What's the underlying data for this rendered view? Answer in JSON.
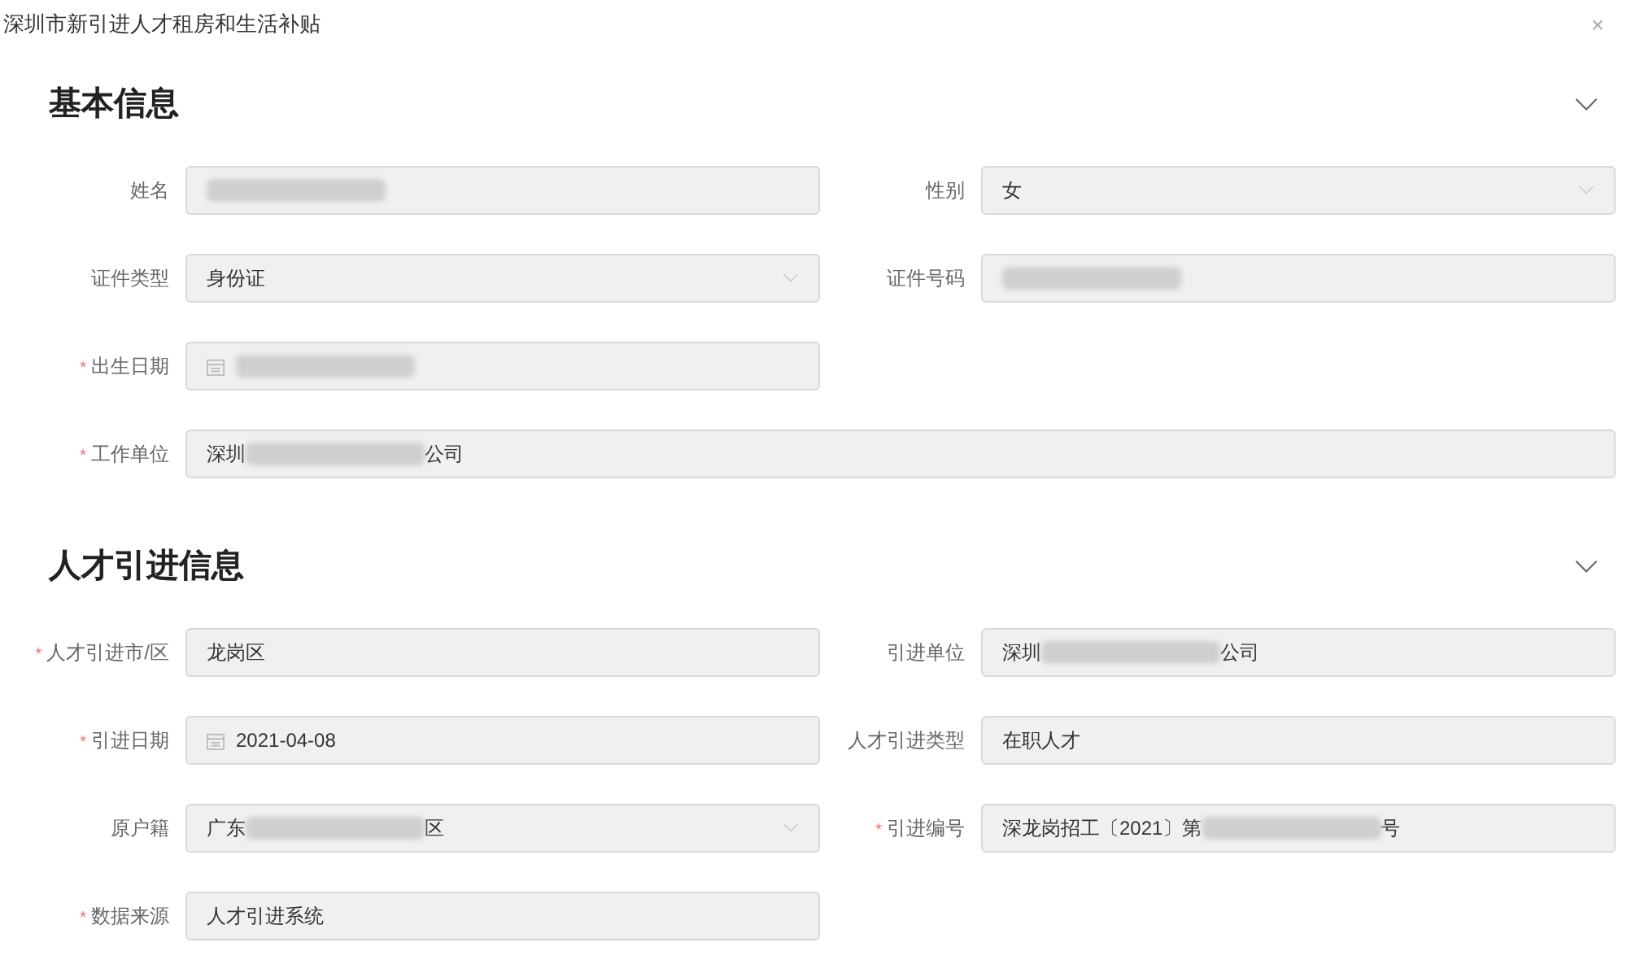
{
  "dialog": {
    "title": "深圳市新引进人才租房和生活补贴",
    "close": "×"
  },
  "sections": [
    {
      "heading": "基本信息",
      "expanded": true,
      "fields": [
        {
          "label": "姓名",
          "kind": "input",
          "parts": [
            {
              "kind": "redacted"
            }
          ]
        },
        {
          "label": "性别",
          "kind": "select",
          "parts": [
            {
              "kind": "text",
              "text": "女"
            }
          ]
        },
        {
          "label": "证件类型",
          "kind": "select",
          "parts": [
            {
              "kind": "text",
              "text": "身份证"
            }
          ]
        },
        {
          "label": "证件号码",
          "kind": "input",
          "parts": [
            {
              "kind": "redacted"
            }
          ]
        },
        {
          "required_mark": "*",
          "label": "出生日期",
          "kind": "date",
          "parts": [
            {
              "kind": "redacted"
            }
          ]
        },
        {
          "required_mark": "*",
          "label": "工作单位",
          "kind": "wide-input",
          "parts": [
            {
              "kind": "text",
              "text": "深圳"
            },
            {
              "kind": "redacted"
            },
            {
              "kind": "text",
              "text": "公司"
            }
          ]
        }
      ]
    },
    {
      "heading": "人才引进信息",
      "expanded": true,
      "fields": [
        {
          "required_mark": "*",
          "label": "人才引进市/区",
          "kind": "input",
          "parts": [
            {
              "kind": "text",
              "text": "龙岗区"
            }
          ]
        },
        {
          "label": "引进单位",
          "kind": "input",
          "parts": [
            {
              "kind": "text",
              "text": "深圳"
            },
            {
              "kind": "redacted"
            },
            {
              "kind": "text",
              "text": "公司"
            }
          ]
        },
        {
          "required_mark": "*",
          "label": "引进日期",
          "kind": "date",
          "parts": [
            {
              "kind": "text",
              "text": "2021-04-08"
            }
          ]
        },
        {
          "label": "人才引进类型",
          "kind": "input",
          "parts": [
            {
              "kind": "text",
              "text": "在职人才"
            }
          ]
        },
        {
          "label": "原户籍",
          "kind": "select",
          "parts": [
            {
              "kind": "text",
              "text": "广东"
            },
            {
              "kind": "redacted"
            },
            {
              "kind": "text",
              "text": "区"
            }
          ]
        },
        {
          "required_mark": "*",
          "label": "引进编号",
          "kind": "input",
          "parts": [
            {
              "kind": "text",
              "text": "深龙岗招工〔2021〕第"
            },
            {
              "kind": "redacted"
            },
            {
              "kind": "text",
              "text": "号"
            }
          ]
        },
        {
          "required_mark": "*",
          "label": "数据来源",
          "kind": "input",
          "parts": [
            {
              "kind": "text",
              "text": "人才引进系统"
            }
          ]
        }
      ]
    }
  ]
}
